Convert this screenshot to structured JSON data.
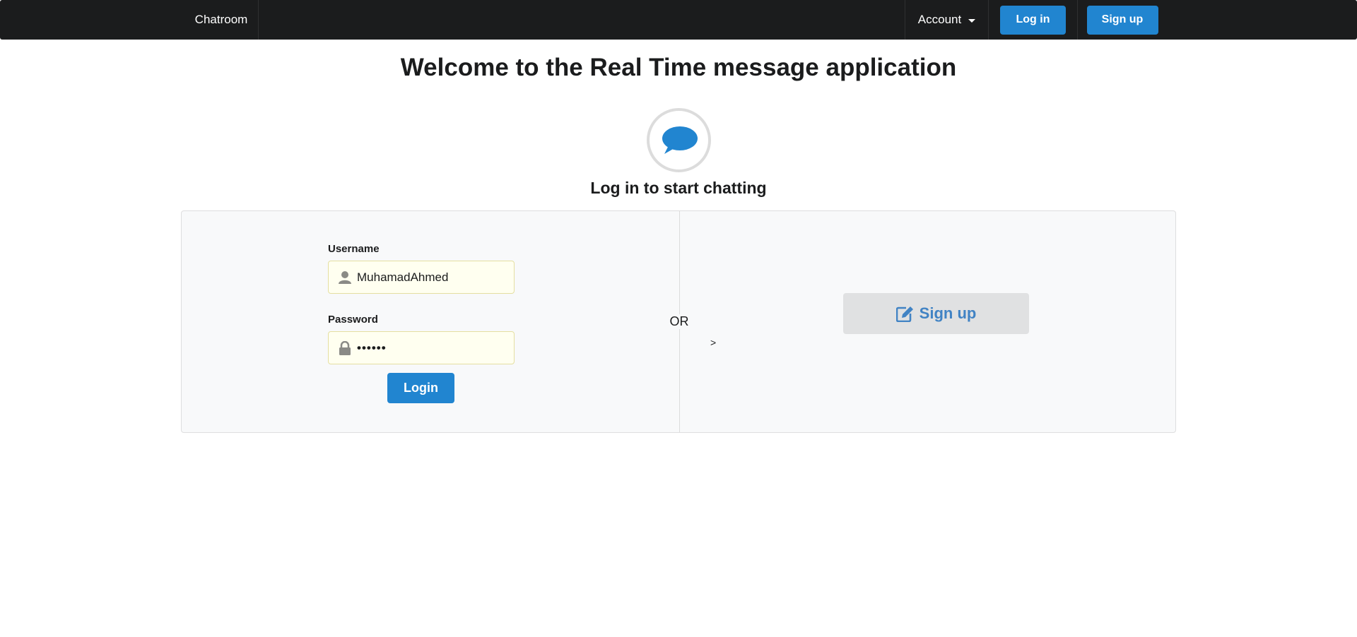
{
  "nav": {
    "brand": "Chatroom",
    "account_label": "Account",
    "login_label": "Log in",
    "signup_label": "Sign up"
  },
  "header": {
    "title": "Welcome to the Real Time message application",
    "icon": "chat-bubble-icon",
    "subtitle": "Log in to start chatting"
  },
  "login_form": {
    "username_label": "Username",
    "username_value": "MuhamadAhmed",
    "username_icon": "user-icon",
    "password_label": "Password",
    "password_value": "••••••",
    "password_icon": "lock-icon",
    "submit_label": "Login"
  },
  "divider": {
    "or_label": "OR",
    "stray_text": ">"
  },
  "signup_panel": {
    "button_label": "Sign up",
    "button_icon": "edit-icon"
  },
  "colors": {
    "nav_bg": "#1b1c1d",
    "primary": "#2185d0",
    "link": "#4183c4",
    "segment_bg": "#f8f9fa",
    "input_bg": "#fffff0"
  }
}
